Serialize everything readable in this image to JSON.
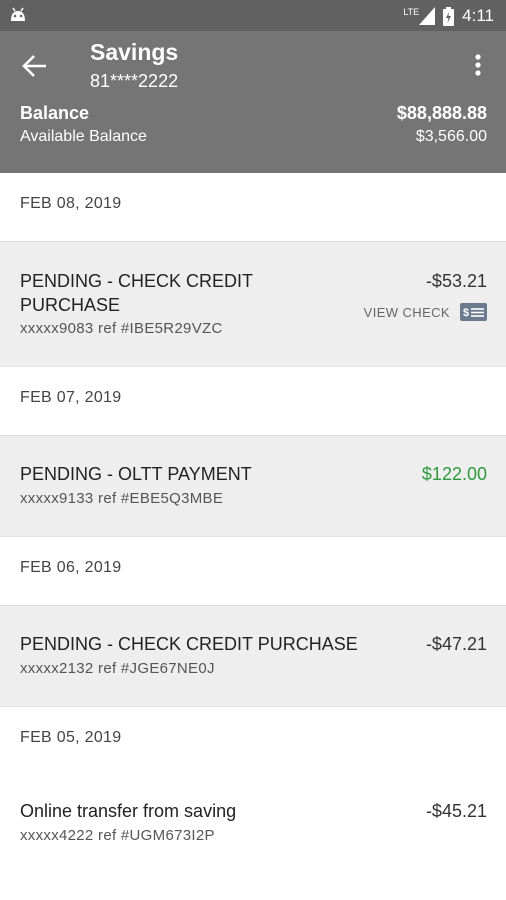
{
  "status_bar": {
    "time": "4:11",
    "network": "LTE",
    "icons": [
      "android-icon",
      "signal-icon",
      "battery-icon"
    ]
  },
  "header": {
    "title": "Savings",
    "account_number": "81****2222",
    "balance_label": "Balance",
    "balance_value": "$88,888.88",
    "available_label": "Available Balance",
    "available_value": "$3,566.00",
    "icons": [
      "back-arrow-icon",
      "more-vert-icon"
    ]
  },
  "transactions": {
    "groups": [
      {
        "date": "FEB 08, 2019",
        "items": [
          {
            "desc_line1": "PENDING - CHECK CREDIT",
            "desc_line2": "PURCHASE",
            "ref": "xxxxx9083 ref #IBE5R29VZC",
            "amount": "-$53.21",
            "action": "VIEW CHECK"
          }
        ]
      },
      {
        "date": "FEB 07, 2019",
        "items": [
          {
            "desc": "PENDING - OLTT PAYMENT",
            "ref": "xxxxx9133 ref #EBE5Q3MBE",
            "amount": "$122.00"
          }
        ]
      },
      {
        "date": "FEB 06, 2019",
        "items": [
          {
            "desc": "PENDING - CHECK CREDIT PURCHASE",
            "ref": "xxxxx2132 ref #JGE67NE0J",
            "amount": "-$47.21"
          }
        ]
      },
      {
        "date": "FEB 05, 2019",
        "items": [
          {
            "desc": "Online transfer from saving",
            "ref": "xxxxx4222 ref #UGM673I2P",
            "amount": "-$45.21"
          }
        ]
      }
    ]
  },
  "colors": {
    "status_bar": "#616161",
    "header": "#757575",
    "credit_amount": "#2e9a3c"
  }
}
